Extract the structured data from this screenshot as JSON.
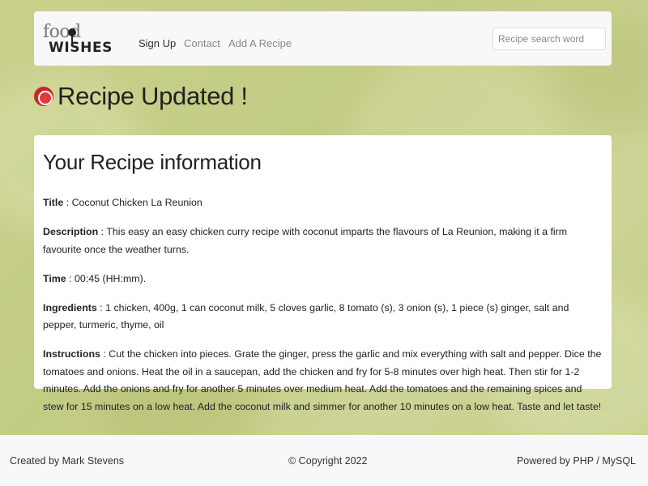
{
  "navbar": {
    "logo": {
      "line1": "food",
      "line2": "WISHES"
    },
    "links": [
      {
        "label": "Sign Up",
        "active": true
      },
      {
        "label": "Contact",
        "active": false
      },
      {
        "label": "Add A Recipe",
        "active": false
      }
    ],
    "search": {
      "placeholder": "Recipe search word",
      "value": ""
    }
  },
  "header": {
    "title": "Recipe Updated !",
    "icon": "plate-icon"
  },
  "card": {
    "title": "Your Recipe information",
    "fields": [
      {
        "label": "Title",
        "sep": " : ",
        "value": "Coconut Chicken La Reunion"
      },
      {
        "label": "Description",
        "sep": " : ",
        "value": "This easy an easy chicken curry recipe with coconut imparts the flavours of La Reunion, making it a firm favourite once the weather turns."
      },
      {
        "label": "Time",
        "sep": " : ",
        "value": "00:45 (HH:mm)."
      },
      {
        "label": "Ingredients",
        "sep": " : ",
        "value": "1 chicken, 400g, 1 can coconut milk, 5 cloves garlic, 8 tomato (s), 3 onion (s), 1 piece (s) ginger, salt and pepper, turmeric, thyme, oil"
      },
      {
        "label": "Instructions",
        "sep": " : ",
        "value": "Cut the chicken into pieces. Grate the ginger, press the garlic and mix everything with salt and pepper. Dice the tomatoes and onions. Heat the oil in a saucepan, add the chicken and fry for 5-8 minutes over high heat. Then stir for 1-2 minutes. Add the onions and fry for another 5 minutes over medium heat. Add the tomatoes and the remaining spices and stew for 15 minutes on a low heat. Add the coconut milk and simmer for another 10 minutes on a low heat. Taste and let taste!"
      }
    ]
  },
  "footer": {
    "left": "Created by Mark Stevens",
    "center": "© Copyright 2022",
    "right": "Powered by PHP / MySQL"
  },
  "colors": {
    "accent_icon": "#c62828",
    "navbar_bg": "#f7f8f9",
    "page_bg": "#c7d08a"
  }
}
